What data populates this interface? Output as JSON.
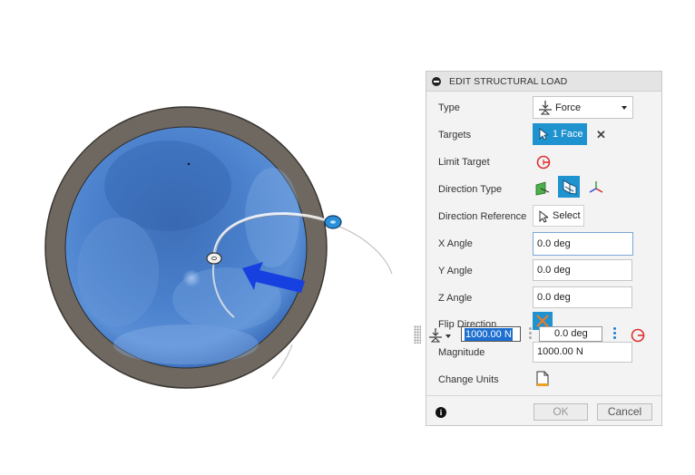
{
  "dialog": {
    "title": "EDIT STRUCTURAL LOAD",
    "type": {
      "label": "Type",
      "value": "Force"
    },
    "targets": {
      "label": "Targets",
      "button": "1 Face"
    },
    "limit_target": {
      "label": "Limit Target"
    },
    "direction_type": {
      "label": "Direction Type"
    },
    "direction_reference": {
      "label": "Direction Reference",
      "button": "Select"
    },
    "x_angle": {
      "label": "X Angle",
      "value": "0.0 deg"
    },
    "y_angle": {
      "label": "Y Angle",
      "value": "0.0 deg"
    },
    "z_angle": {
      "label": "Z Angle",
      "value": "0.0 deg"
    },
    "flip_direction": {
      "label": "Flip Direction"
    },
    "magnitude": {
      "label": "Magnitude",
      "value": "1000.00 N"
    },
    "change_units": {
      "label": "Change Units"
    },
    "ok": "OK",
    "cancel": "Cancel",
    "info_icon": "i"
  },
  "mini_toolbar": {
    "magnitude_value": "1000.00 N",
    "angle_value": "0.0 deg"
  },
  "colors": {
    "accent": "#1f93d0",
    "sphere_blue": "#4a7fc8",
    "rim": "#6e6860",
    "arrow": "#1740e0",
    "limit_icon": "#e03030"
  }
}
